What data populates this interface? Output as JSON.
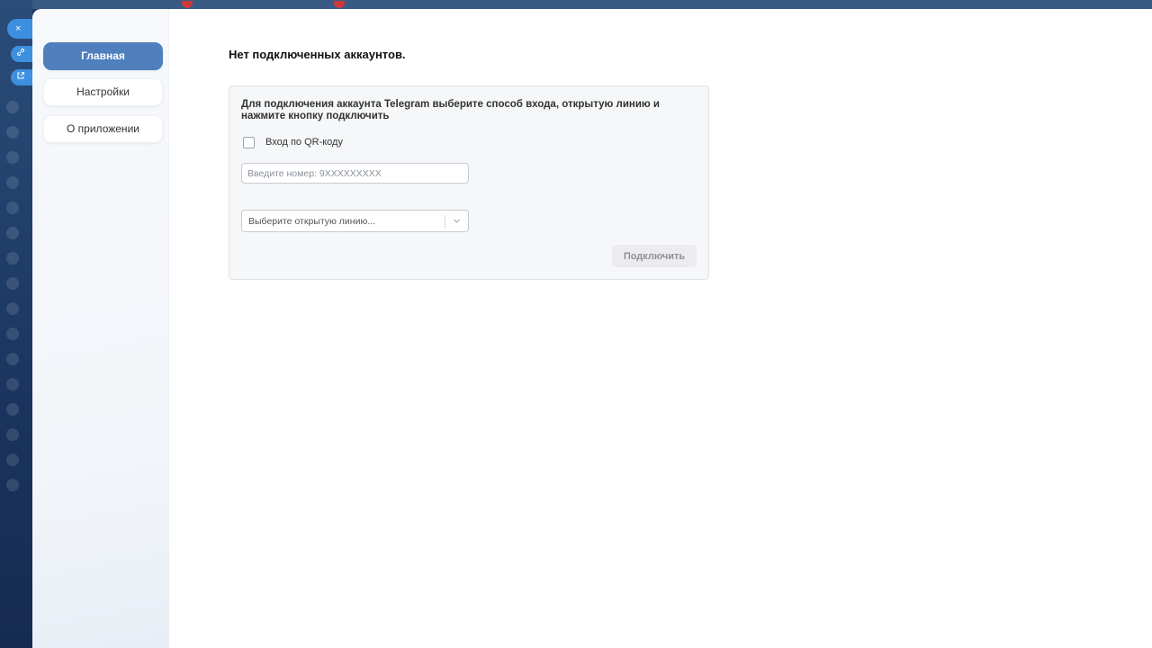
{
  "nav": {
    "items": [
      {
        "label": "Главная",
        "active": true
      },
      {
        "label": "Настройки",
        "active": false
      },
      {
        "label": "О приложении",
        "active": false
      }
    ]
  },
  "main": {
    "title": "Нет подключенных аккаунтов.",
    "card": {
      "instructions": "Для подключения аккаунта Telegram выберите способ входа, открытую линию и нажмите кнопку подключить",
      "qr_checkbox_label": "Вход по QR-коду",
      "qr_checked": false,
      "phone_placeholder": "Введите номер: 9XXXXXXXXX",
      "phone_value": "",
      "line_select_placeholder": "Выберите открытую линию...",
      "connect_label": "Подключить"
    }
  },
  "background": {
    "close_glyph": "×"
  },
  "colors": {
    "accent": "#4f7fbd",
    "background_app": "#1f3b67"
  }
}
